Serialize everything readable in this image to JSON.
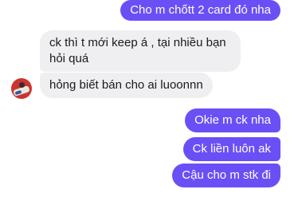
{
  "messages": [
    {
      "id": "m1",
      "direction": "outgoing",
      "text": "Cho m chốtt 2 card đó nha"
    },
    {
      "id": "m2",
      "direction": "incoming",
      "lines": [
        "ck thì t mới keep á , tại nhiều bạn",
        "hỏi quá"
      ]
    },
    {
      "id": "m3",
      "direction": "incoming",
      "text": "hỏng biết bán cho ai luoonnn"
    },
    {
      "id": "m4",
      "direction": "outgoing",
      "text": "Okie m ck nha"
    },
    {
      "id": "m5",
      "direction": "outgoing",
      "text": "Ck liền luôn ak"
    },
    {
      "id": "m6",
      "direction": "outgoing",
      "text": "Cậu cho m stk đi"
    }
  ],
  "colors": {
    "outgoing_bubble": "#6a4ff7",
    "incoming_bubble": "#efeff1",
    "avatar_bg": "#c9362f"
  },
  "icons": {
    "contact_avatar": "avatar"
  }
}
